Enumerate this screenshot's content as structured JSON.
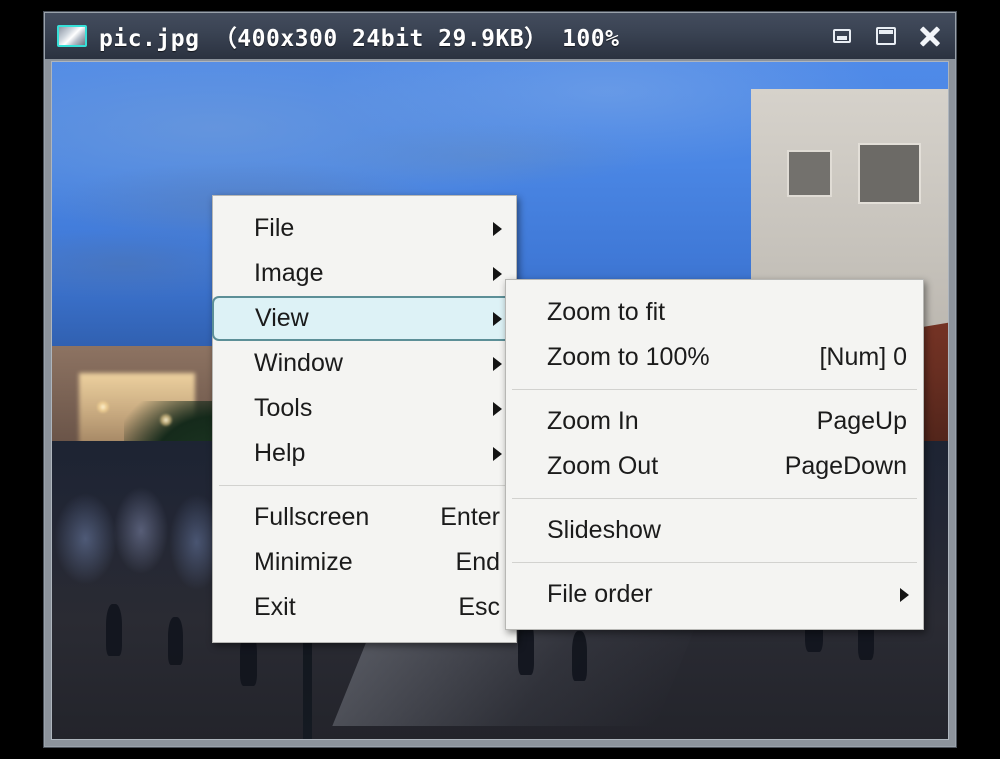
{
  "window": {
    "title": "pic.jpg （400x300  24bit  29.9KB） 100%",
    "filename": "pic.jpg",
    "dimensions": "400x300",
    "color_depth": "24bit",
    "file_size": "29.9KB",
    "zoom_level": "100%",
    "icon": "image-viewer-icon",
    "controls": {
      "minimize": "minimize-icon",
      "maximize": "maximize-icon",
      "close": "close-icon"
    },
    "titlebar_color": "#3a4353",
    "frame_color": "#8c939c"
  },
  "context_menu": {
    "groups": [
      {
        "items": [
          {
            "label": "File",
            "accel": "",
            "has_submenu": true,
            "selected": false
          },
          {
            "label": "Image",
            "accel": "",
            "has_submenu": true,
            "selected": false
          },
          {
            "label": "View",
            "accel": "",
            "has_submenu": true,
            "selected": true
          },
          {
            "label": "Window",
            "accel": "",
            "has_submenu": true,
            "selected": false
          },
          {
            "label": "Tools",
            "accel": "",
            "has_submenu": true,
            "selected": false
          },
          {
            "label": "Help",
            "accel": "",
            "has_submenu": true,
            "selected": false
          }
        ]
      },
      {
        "items": [
          {
            "label": "Fullscreen",
            "accel": "Enter",
            "has_submenu": false,
            "selected": false
          },
          {
            "label": "Minimize",
            "accel": "End",
            "has_submenu": false,
            "selected": false
          },
          {
            "label": "Exit",
            "accel": "Esc",
            "has_submenu": false,
            "selected": false
          }
        ]
      }
    ],
    "highlight_color": "#ddf2f6",
    "highlight_border": "#5c8f97"
  },
  "view_submenu": {
    "groups": [
      {
        "items": [
          {
            "label": "Zoom to fit",
            "accel": "",
            "has_submenu": false
          },
          {
            "label": "Zoom to 100%",
            "accel": "[Num] 0",
            "has_submenu": false
          }
        ]
      },
      {
        "items": [
          {
            "label": "Zoom In",
            "accel": "PageUp",
            "has_submenu": false
          },
          {
            "label": "Zoom Out",
            "accel": "PageDown",
            "has_submenu": false
          }
        ]
      },
      {
        "items": [
          {
            "label": "Slideshow",
            "accel": "",
            "has_submenu": false
          }
        ]
      },
      {
        "items": [
          {
            "label": "File order",
            "accel": "",
            "has_submenu": true
          }
        ]
      }
    ]
  },
  "photo": {
    "description": "dusk street scene with historic red-tile-roof building and crowd"
  }
}
